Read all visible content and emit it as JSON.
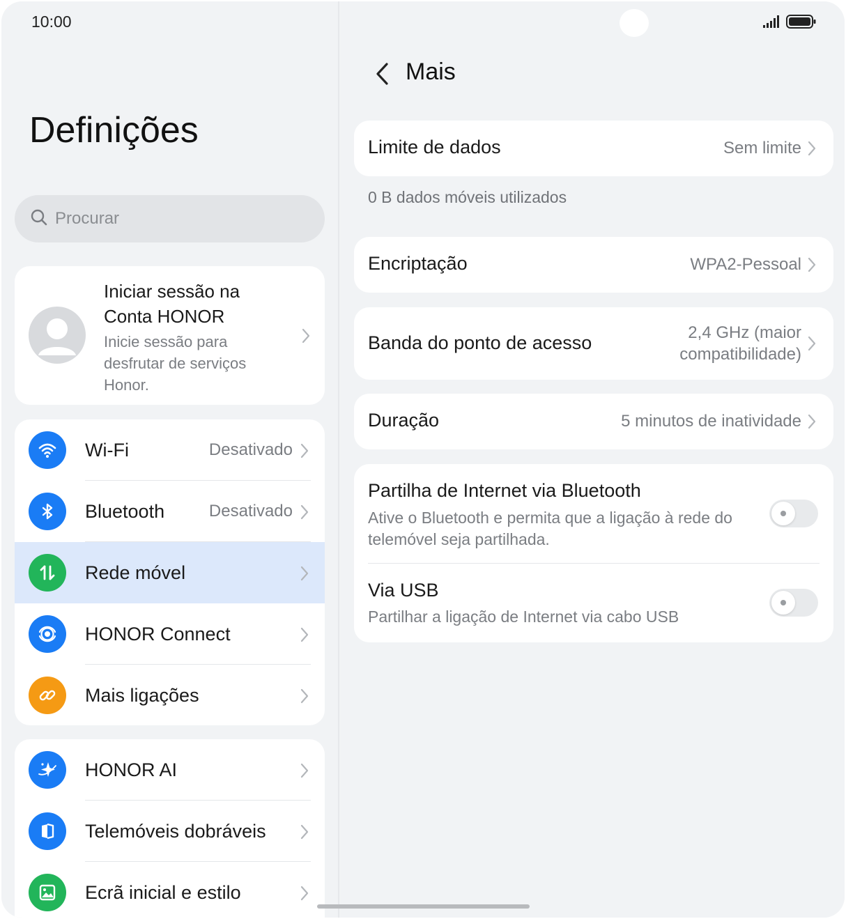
{
  "status_bar": {
    "time": "10:00"
  },
  "left": {
    "title": "Definições",
    "search": {
      "placeholder": "Procurar"
    },
    "account": {
      "title": "Iniciar sessão na Conta HONOR",
      "subtitle": "Inicie sessão para desfrutar de serviços Honor."
    },
    "group1": [
      {
        "label": "Wi-Fi",
        "value": "Desativado",
        "icon": "wifi-icon",
        "color": "#1a7cf5"
      },
      {
        "label": "Bluetooth",
        "value": "Desativado",
        "icon": "bluetooth-icon",
        "color": "#1a7cf5"
      },
      {
        "label": "Rede móvel",
        "value": "",
        "icon": "mobile-network-icon",
        "color": "#22b55a",
        "selected": true
      },
      {
        "label": "HONOR Connect",
        "value": "",
        "icon": "honor-connect-icon",
        "color": "#1a7cf5"
      },
      {
        "label": "Mais ligações",
        "value": "",
        "icon": "link-icon",
        "color": "#f59a14"
      }
    ],
    "group2": [
      {
        "label": "HONOR AI",
        "icon": "ai-sparkle-icon",
        "color": "#1a7cf5"
      },
      {
        "label": "Telemóveis dobráveis",
        "icon": "foldable-phone-icon",
        "color": "#1a7cf5"
      },
      {
        "label": "Ecrã inicial e estilo",
        "icon": "wallpaper-icon",
        "color": "#22b55a"
      }
    ]
  },
  "right": {
    "title": "Mais",
    "data_limit": {
      "label": "Limite de dados",
      "value": "Sem limite"
    },
    "data_used": "0 B dados móveis utilizados",
    "encryption": {
      "label": "Encriptação",
      "value": "WPA2-Pessoal"
    },
    "band": {
      "label": "Banda do ponto de acesso",
      "value_line1": "2,4 GHz (maior",
      "value_line2": "compatibilidade)"
    },
    "duration": {
      "label": "Duração",
      "value": "5 minutos de inatividade"
    },
    "bluetooth_tether": {
      "label": "Partilha de Internet via Bluetooth",
      "desc": "Ative o Bluetooth e permita que a ligação à rede do telemóvel seja partilhada.",
      "enabled": false
    },
    "usb_tether": {
      "label": "Via USB",
      "desc": "Partilhar a ligação de Internet via cabo USB",
      "enabled": false
    }
  }
}
